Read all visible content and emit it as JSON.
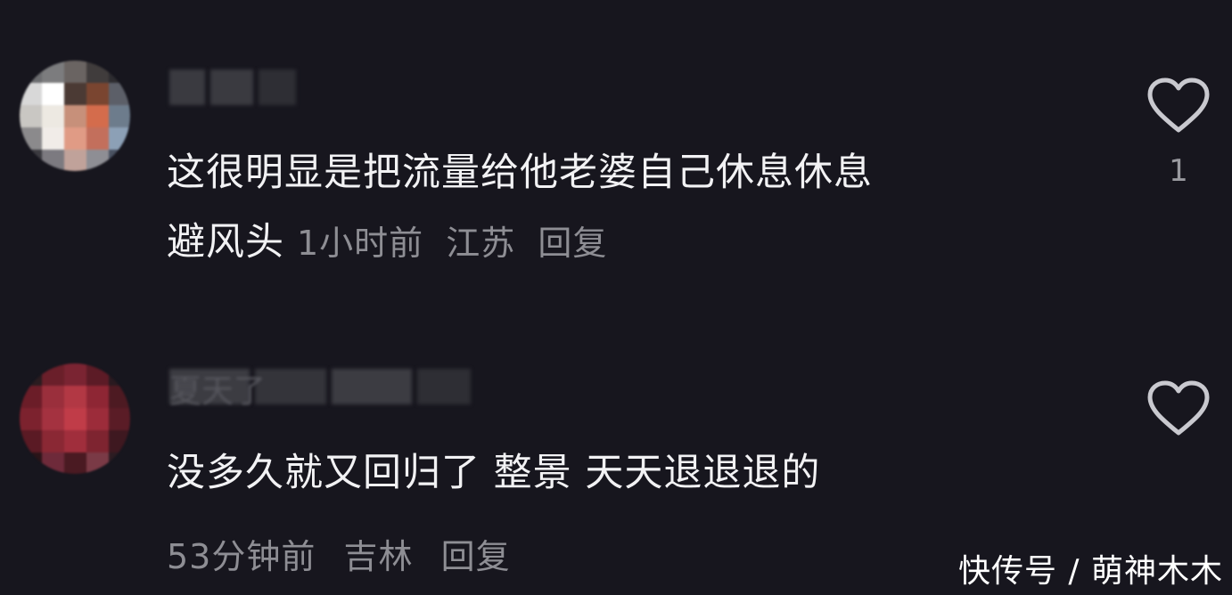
{
  "comments": [
    {
      "username": "",
      "text_line1": "这很明显是把流量给他老婆自己休息休息",
      "text_line2": "避风头",
      "time": "1小时前",
      "location": "江苏",
      "reply_label": "回复",
      "like_count": "1"
    },
    {
      "username": "夏天了",
      "text": "没多久就又回归了 整景 天天退退退的",
      "time": "53分钟前",
      "location": "吉林",
      "reply_label": "回复",
      "like_count": ""
    }
  ],
  "watermark": "快传号 / 萌神木木",
  "icons": {
    "like": "heart-outline-icon"
  },
  "colors": {
    "background": "#17161e",
    "text": "#f2f2f4",
    "meta": "#8e8e94"
  }
}
